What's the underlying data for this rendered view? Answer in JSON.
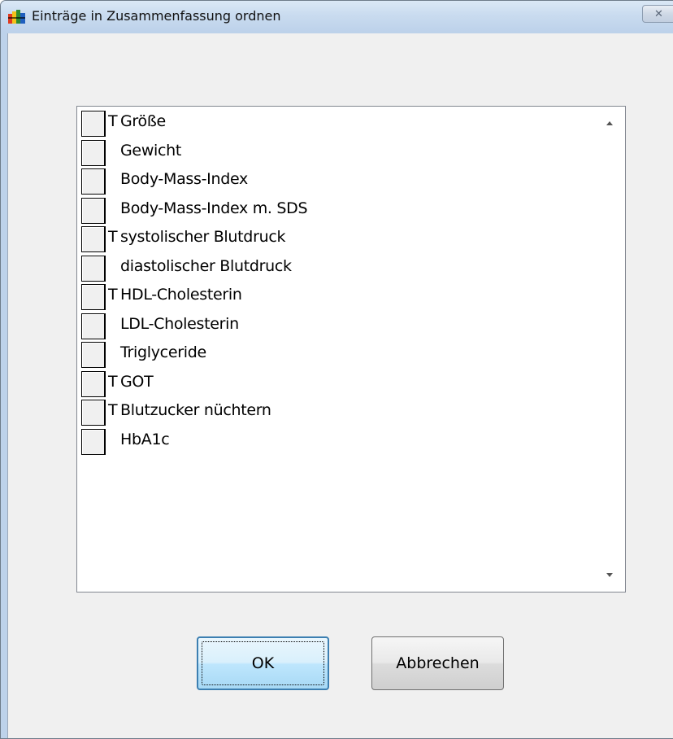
{
  "window": {
    "title": "Einträge in Zusammenfassung ordnen",
    "close_glyph": "✕"
  },
  "list": {
    "items": [
      {
        "flag": "T",
        "label": "Größe",
        "checked": false
      },
      {
        "flag": "",
        "label": "Gewicht",
        "checked": false
      },
      {
        "flag": "",
        "label": "Body-Mass-Index",
        "checked": false
      },
      {
        "flag": "",
        "label": "Body-Mass-Index m. SDS",
        "checked": false
      },
      {
        "flag": "T",
        "label": "systolischer Blutdruck",
        "checked": false
      },
      {
        "flag": "",
        "label": "diastolischer Blutdruck",
        "checked": false
      },
      {
        "flag": "T",
        "label": "HDL-Cholesterin",
        "checked": false
      },
      {
        "flag": "",
        "label": "LDL-Cholesterin",
        "checked": false
      },
      {
        "flag": "",
        "label": "Triglyceride",
        "checked": false
      },
      {
        "flag": "T",
        "label": "GOT",
        "checked": false
      },
      {
        "flag": "T",
        "label": "Blutzucker nüchtern",
        "checked": false
      },
      {
        "flag": "",
        "label": "HbA1c",
        "checked": false
      }
    ]
  },
  "buttons": {
    "ok_label": "OK",
    "cancel_label": "Abbrechen"
  },
  "icons": {
    "app": "app-icon",
    "close": "close-icon",
    "scroll_up": "scroll-up-arrow-icon",
    "scroll_down": "scroll-down-arrow-icon"
  }
}
